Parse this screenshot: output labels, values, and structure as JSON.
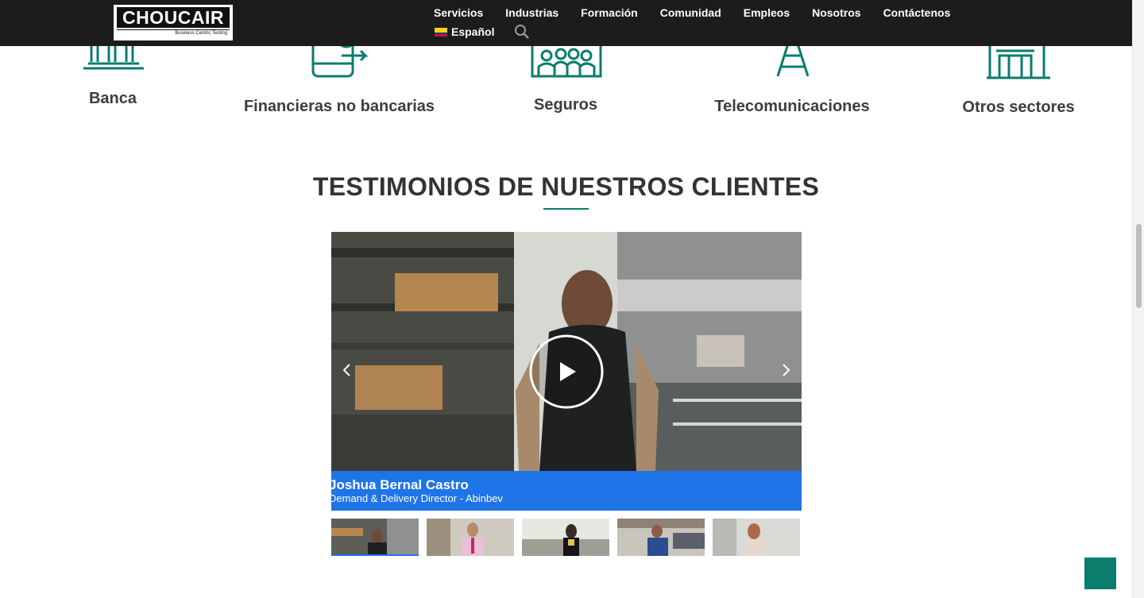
{
  "header": {
    "logo_text": "CHOUCAIR",
    "logo_tagline": "Business Centric Testing",
    "nav": [
      "Servicios",
      "Industrias",
      "Formación",
      "Comunidad",
      "Empleos",
      "Nosotros",
      "Contáctenos"
    ],
    "language": "Español"
  },
  "industries": [
    {
      "label": "Banca",
      "icon": "bank-icon"
    },
    {
      "label": "Financieras no bancarias",
      "icon": "mobile-payment-icon"
    },
    {
      "label": "Seguros",
      "icon": "insurance-building-icon"
    },
    {
      "label": "Telecomunicaciones",
      "icon": "antenna-tower-icon"
    },
    {
      "label": "Otros sectores",
      "icon": "factory-icon"
    }
  ],
  "testimonials": {
    "title": "TESTIMONIOS DE NUESTROS CLIENTES",
    "video": {
      "name": "Joshua Bernal Castro",
      "role": "Demand & Delivery Director - Abinbev"
    },
    "thumbnail_count": 5,
    "active_thumbnail": 1
  },
  "colors": {
    "accent": "#0a7d6c",
    "caption_blue": "#1f74e8",
    "header_bg": "#1c1c1c",
    "text_dark": "#333333"
  }
}
